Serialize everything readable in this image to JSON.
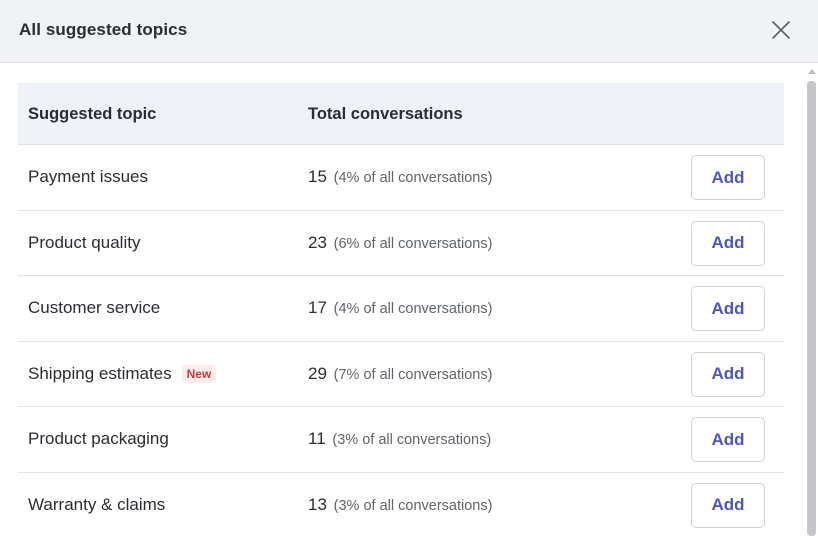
{
  "dialog": {
    "title": "All suggested topics",
    "close_icon": "close-icon"
  },
  "table": {
    "headers": {
      "topic": "Suggested topic",
      "total": "Total conversations"
    },
    "rows": [
      {
        "topic": "Payment issues",
        "count": "15",
        "percent": "(4% of all conversations)",
        "badge": "",
        "action": "Add"
      },
      {
        "topic": "Product quality",
        "count": "23",
        "percent": "(6% of all conversations)",
        "badge": "",
        "action": "Add"
      },
      {
        "topic": "Customer service",
        "count": "17",
        "percent": "(4% of all conversations)",
        "badge": "",
        "action": "Add"
      },
      {
        "topic": "Shipping estimates",
        "count": "29",
        "percent": "(7% of all conversations)",
        "badge": "New",
        "action": "Add"
      },
      {
        "topic": "Product packaging",
        "count": "11",
        "percent": "(3% of all conversations)",
        "badge": "",
        "action": "Add"
      },
      {
        "topic": "Warranty & claims",
        "count": "13",
        "percent": "(3% of all conversations)",
        "badge": "",
        "action": "Add"
      }
    ]
  },
  "colors": {
    "accent": "#4a56c9",
    "badge_text": "#c2413a",
    "badge_bg": "#fdecea",
    "header_bg": "#f1f2f4"
  }
}
